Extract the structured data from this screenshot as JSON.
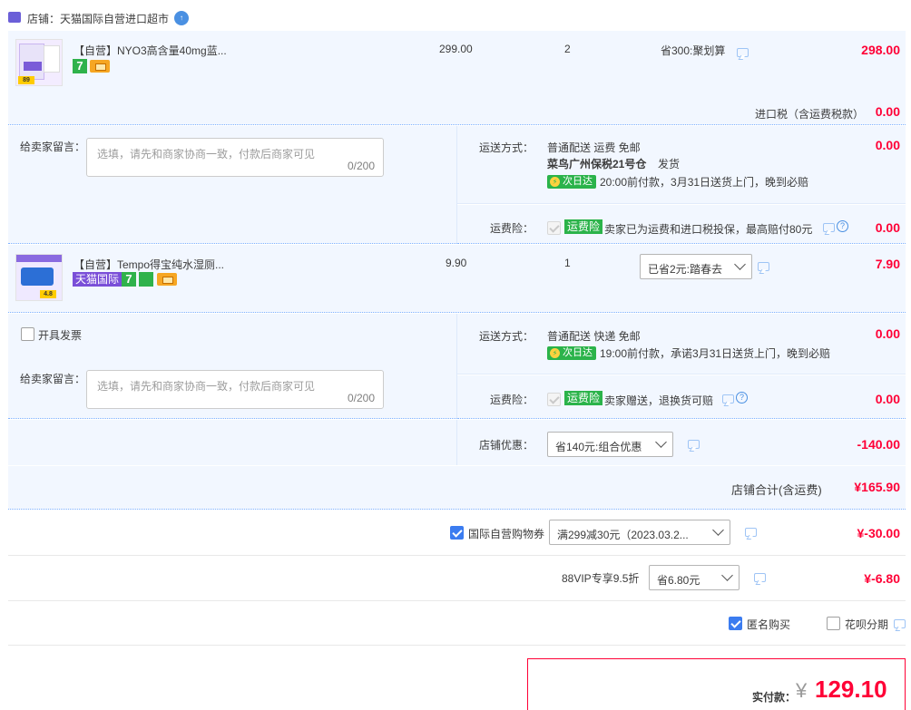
{
  "shop": {
    "icon": "tmall-cat-icon",
    "name": "店铺：天猫国际自营进口超市",
    "badge_icon": "chat-bubble-icon"
  },
  "item1": {
    "title": "【自营】NYO3高含量40mg蓝...",
    "price": "299.00",
    "qty": "2",
    "promo": "省300:聚划算",
    "subtotal": "298.00",
    "thumb_badge": "89",
    "tax_label": "进口税（含运费税款）",
    "tax_value": "0.00"
  },
  "block1": {
    "note_label": "给卖家留言：",
    "note_placeholder": "选填，请先和商家协商一致，付款后商家可见",
    "note_count": "0/200",
    "ship_label": "运送方式：",
    "ship_method": "普通配送 运费 免邮",
    "ship_value": "0.00",
    "warehouse": "菜鸟广州保税21号仓",
    "warehouse_suffix": "发货",
    "nextday_tag": "次日达",
    "ship_detail": "20:00前付款，3月31日送货上门，晚到必赔",
    "insure_label": "运费险：",
    "insure_tag": "运费险",
    "insure_text": "卖家已为运费和进口税投保，最高赔付80元",
    "insure_value": "0.00"
  },
  "item2": {
    "title": "【自营】Tempo得宝纯水湿厕...",
    "price": "9.90",
    "qty": "1",
    "promo_select": "已省2元:踏春去",
    "subtotal": "7.90",
    "tmall_tag": "天猫国际",
    "thumb_badge": "4.8"
  },
  "block2": {
    "invoice_label": "开具发票",
    "note_label": "给卖家留言：",
    "note_placeholder": "选填，请先和商家协商一致，付款后商家可见",
    "note_count": "0/200",
    "ship_label": "运送方式：",
    "ship_method": "普通配送 快递 免邮",
    "ship_value": "0.00",
    "nextday_tag": "次日达",
    "ship_detail": "19:00前付款，承诺3月31日送货上门，晚到必赔",
    "insure_label": "运费险：",
    "insure_tag": "运费险",
    "insure_text": "卖家赠送，退换货可赔",
    "insure_value": "0.00"
  },
  "shop_discount": {
    "label": "店铺优惠：",
    "select": "省140元:组合优惠",
    "value": "-140.00"
  },
  "shop_total": {
    "label": "店铺合计(含运费)",
    "value": "¥165.90"
  },
  "coupon": {
    "label": "国际自营购物券",
    "select": "满299减30元（2023.03.2...",
    "value": "¥-30.00"
  },
  "vip": {
    "label": "88VIP专享9.5折",
    "select": "省6.80元",
    "value": "¥-6.80"
  },
  "options": {
    "anonymous": "匿名购买",
    "huabei": "花呗分期"
  },
  "pay": {
    "label": "实付款：",
    "currency": "¥",
    "amount": "129.10"
  },
  "colors": {
    "accent_red": "#ff0036",
    "panel_blue": "#f2f7ff",
    "checkbox_blue": "#3b7cf0",
    "green_tag": "#2bb34a"
  }
}
